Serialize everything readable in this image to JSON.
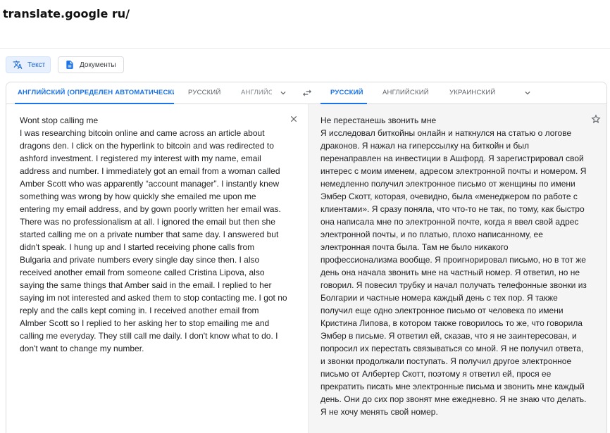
{
  "page": {
    "title": "translate.google ru/"
  },
  "modes": {
    "text_label": "Текст",
    "docs_label": "Документы"
  },
  "source_langs": [
    {
      "label": "АНГЛИЙСКИЙ (ОПРЕДЕЛЕН АВТОМАТИЧЕСКИ)"
    },
    {
      "label": "РУССКИЙ"
    },
    {
      "label": "АНГЛИЙСК"
    }
  ],
  "target_langs": [
    {
      "label": "РУССКИЙ"
    },
    {
      "label": "АНГЛИЙСКИЙ"
    },
    {
      "label": "УКРАИНСКИЙ"
    }
  ],
  "source": {
    "text": "Wont stop calling me\nI was researching bitcoin online and came across an article about dragons den. I click on the hyperlink to bitcoin and was redirected to ashford investment. I registered my interest with my name, email address and number. I immediately got an email from a woman called Amber Scott who was apparently “account manager”. I instantly knew something was wrong by how quickly she emailed me upon me entering my email address, and by gown poorly written her email was. There was no professionalism at all. I ignored the email but then she started calling me on a private number that same day. I answered but didn't speak. I hung up and I started receiving phone calls from Bulgaria and private numbers every single day since then. I also received another email from someone called Cristina Lipova, also saying the same things that Amber said in the email. I replied to her saying im not interested and asked them to stop contacting me. I got no reply and the calls kept coming in. I received another email from Almber Scott so I replied to her asking her to stop emailing me and calling me everyday. They still call me daily. I don't know what to do. I don't want to change my number."
  },
  "target": {
    "text": "Не перестанешь звонить мне\nЯ исследовал биткойны онлайн и наткнулся на статью о логове драконов. Я нажал на гиперссылку на биткойн и был перенаправлен на инвестиции в Ашфорд. Я зарегистрировал свой интерес с моим именем, адресом электронной почты и номером. Я немедленно получил электронное письмо от женщины по имени Эмбер Скотт, которая, очевидно, была «менеджером по работе с клиентами». Я сразу поняла, что что-то не так, по тому, как быстро она написала мне по электронной почте, когда я ввел свой адрес электронной почты, и по платью, плохо написанному, ее электронная почта была. Там не было никакого профессионализма вообще. Я проигнорировал письмо, но в тот же день она начала звонить мне на частный номер. Я ответил, но не говорил. Я повесил трубку и начал получать телефонные звонки из Болгарии и частные номера каждый день с тех пор. Я также получил еще одно электронное письмо от человека по имени Кристина Липова, в котором также говорилось то же, что говорила Эмбер в письме. Я ответил ей, сказав, что я не заинтересован, и попросил их перестать связываться со мной. Я не получил ответа, и звонки продолжали поступать. Я получил другое электронное письмо от Албертер Скотт, поэтому я ответил ей, прося ее прекратить писать мне электронные письма и звонить мне каждый день. Они до сих пор звонят мне ежедневно. Я не знаю что делать. Я не хочу менять свой номер."
  },
  "colors": {
    "accent": "#1a73e8",
    "target_bg": "#f5f5f5",
    "divider": "#dadce0"
  }
}
